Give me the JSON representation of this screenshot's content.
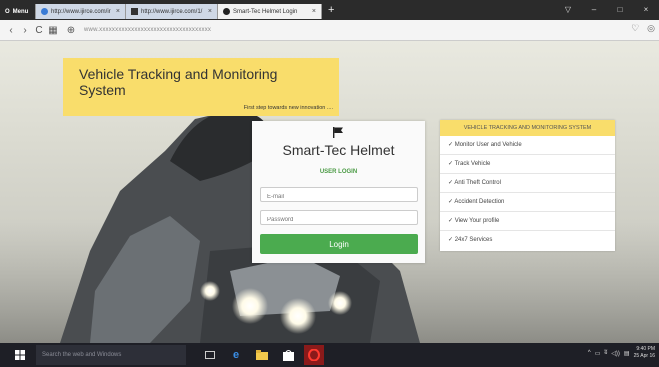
{
  "browser": {
    "menu_label": "Menu",
    "tabs": [
      {
        "label": "http://www.ijirce.com/ir",
        "close": "×"
      },
      {
        "label": "http://www.ijirce.com/1/",
        "close": "×"
      },
      {
        "label": "Smart-Tec Helmet Login",
        "close": "×"
      }
    ],
    "new_tab": "+",
    "window_controls": [
      "▽",
      "–",
      "□",
      "×"
    ],
    "nav": {
      "back": "‹",
      "forward": "›",
      "reload": "C",
      "grid": "▦",
      "globe": "⊕"
    },
    "url": "www.xxxxxxxxxxxxxxxxxxxxxxxxxxxxxxxxxxx"
  },
  "hero": {
    "title": "Vehicle Tracking and Monitoring System",
    "subtitle": "First step towards new innovation ...."
  },
  "login": {
    "brand": "Smart-Tec Helmet",
    "section_title": "USER LOGIN",
    "email_placeholder": "E-mail",
    "password_placeholder": "Password",
    "button": "Login"
  },
  "features": {
    "heading": "VEHICLE TRACKING AND MONITORING SYSTEM",
    "items": [
      "✓ Monitor User and Vehicle",
      "✓ Track Vehicle",
      "✓ Anti Theft Control",
      "✓ Accident Detection",
      "✓ View Your profile",
      "✓ 24x7 Services"
    ]
  },
  "taskbar": {
    "search_placeholder": "Search the web and Windows",
    "tray_icons": [
      "^",
      "▭",
      "ʬ",
      "◁))",
      "▤"
    ],
    "time": "9:40 PM",
    "date": "25 Apr 16"
  },
  "colors": {
    "accent_yellow": "#f9dd6b",
    "login_green": "#4bab4f"
  }
}
